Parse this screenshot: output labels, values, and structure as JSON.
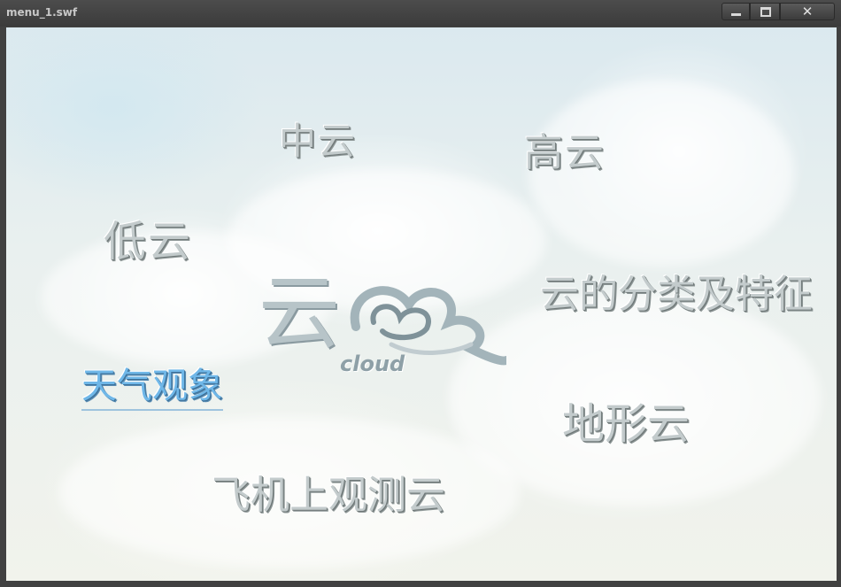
{
  "window": {
    "title": "menu_1.swf",
    "controls": {
      "minimize": "minimize",
      "maximize": "maximize",
      "close": "✕"
    }
  },
  "logo": {
    "char": "云",
    "sub": "cloud"
  },
  "menu": {
    "mid_cloud": "中云",
    "high_cloud": "高云",
    "low_cloud": "低云",
    "classification": "云的分类及特征",
    "weather": "天气观象",
    "terrain_cloud": "地形云",
    "plane_observation": "飞机上观测云"
  },
  "colors": {
    "active": "#6fb7e8",
    "inactive": "#c3cbcc",
    "sky": "#dbe9ef"
  }
}
